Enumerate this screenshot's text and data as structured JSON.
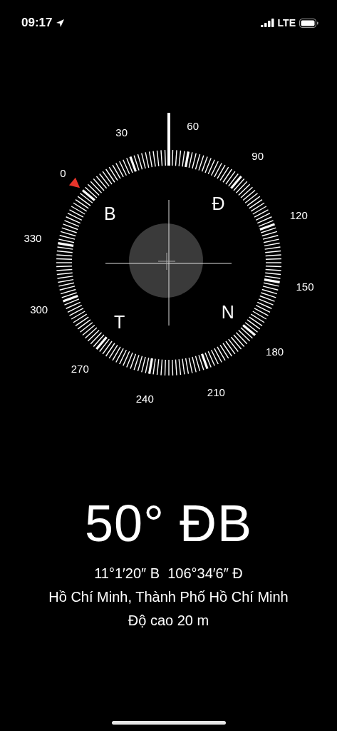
{
  "status_bar": {
    "time": "09:17",
    "network": "LTE"
  },
  "compass": {
    "dial_labels": [
      "0",
      "30",
      "60",
      "90",
      "120",
      "150",
      "180",
      "210",
      "240",
      "270",
      "300",
      "330"
    ],
    "cardinals": [
      {
        "kind": "north",
        "label": "B"
      },
      {
        "kind": "east",
        "label": "Đ"
      },
      {
        "kind": "west",
        "label": "T"
      },
      {
        "kind": "south",
        "label": "N"
      }
    ]
  },
  "heading": "50° ĐB",
  "coordinates": "11°1′20″ B  106°34′6″ Đ",
  "location": "Hồ Chí Minh, Thành Phố Hồ Chí Minh",
  "altitude": "Độ cao 20 m"
}
